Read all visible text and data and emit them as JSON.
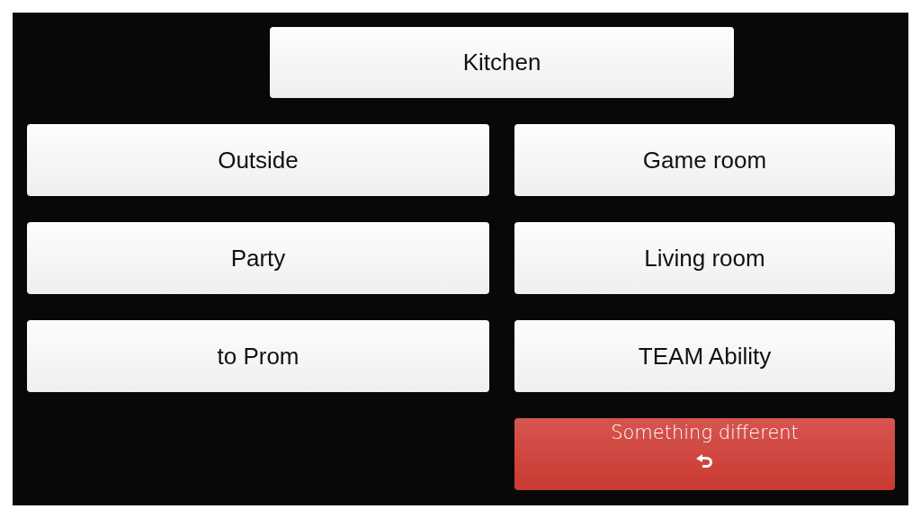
{
  "top_button": {
    "label": "Kitchen",
    "kind": "plain"
  },
  "left_column": [
    {
      "label": "Outside",
      "kind": "plain"
    },
    {
      "label": "Party",
      "kind": "plain"
    },
    {
      "label": "to Prom",
      "kind": "plain"
    }
  ],
  "right_column": [
    {
      "label": "Game room",
      "kind": "plain"
    },
    {
      "label": "Living room",
      "kind": "plain"
    },
    {
      "label": "TEAM Ability",
      "kind": "plain"
    },
    {
      "label": "Something different",
      "kind": "back"
    }
  ]
}
